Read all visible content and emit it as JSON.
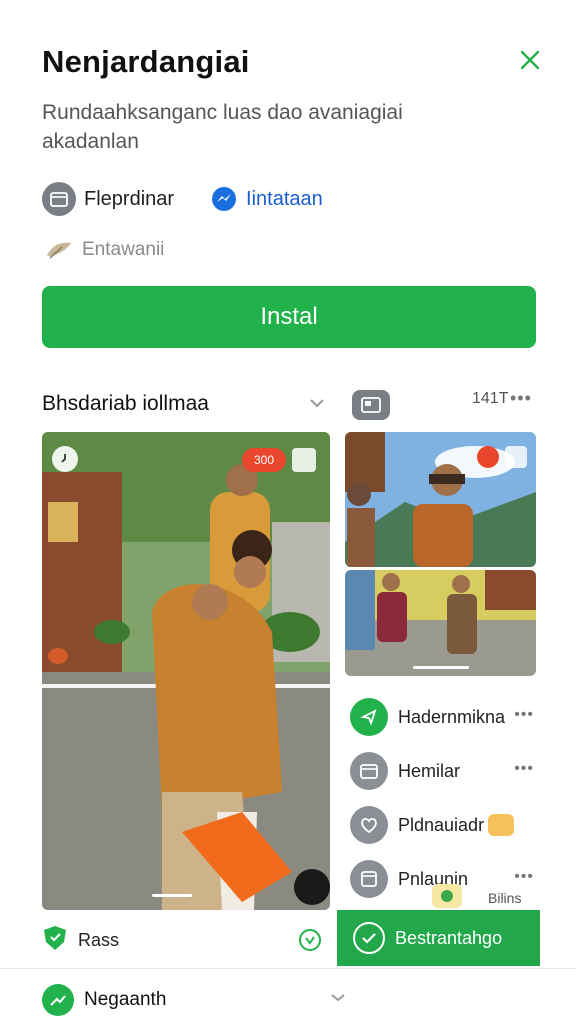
{
  "header": {
    "title": "Nenjardangiai",
    "close_icon": "close-icon"
  },
  "description": "Rundaahksanganc luas dao avaniagiai akadanlan",
  "meta": {
    "item1_label": "Fleprdinar",
    "item1_icon": "calendar-icon",
    "item2_label": "Iintataan",
    "item2_icon": "messenger-icon"
  },
  "tag": {
    "label": "Entawanii",
    "icon": "leaf-icon"
  },
  "install_button": "Instal",
  "section": {
    "title": "Bhsdariab iollmaa",
    "count": "141T",
    "more": "•••"
  },
  "photos": {
    "main_badge": "300",
    "side_badge": "0"
  },
  "actions": [
    {
      "label": "Hadernmikna",
      "icon": "location-icon",
      "color": "#22b24c",
      "more": "•••"
    },
    {
      "label": "Hemilar",
      "icon": "calendar-icon",
      "color": "#8a8f96",
      "more": "•••"
    },
    {
      "label": "Pldnauiadr",
      "icon": "heart-icon",
      "color": "#8a8f96",
      "more": ""
    },
    {
      "label": "Pnlaunin",
      "icon": "document-icon",
      "color": "#8a8f96",
      "more": "•••"
    }
  ],
  "small_count": "Bilins",
  "rate": {
    "label": "Rass",
    "icon": "shield-icon"
  },
  "cta": {
    "label": "Bestrantahgo",
    "icon": "check-circle-icon"
  },
  "bottom": {
    "label": "Negaanth",
    "icon": "trend-icon"
  },
  "colors": {
    "accent_green": "#22b24c",
    "link_blue": "#1a5fd0",
    "badge_red": "#e8472b"
  }
}
